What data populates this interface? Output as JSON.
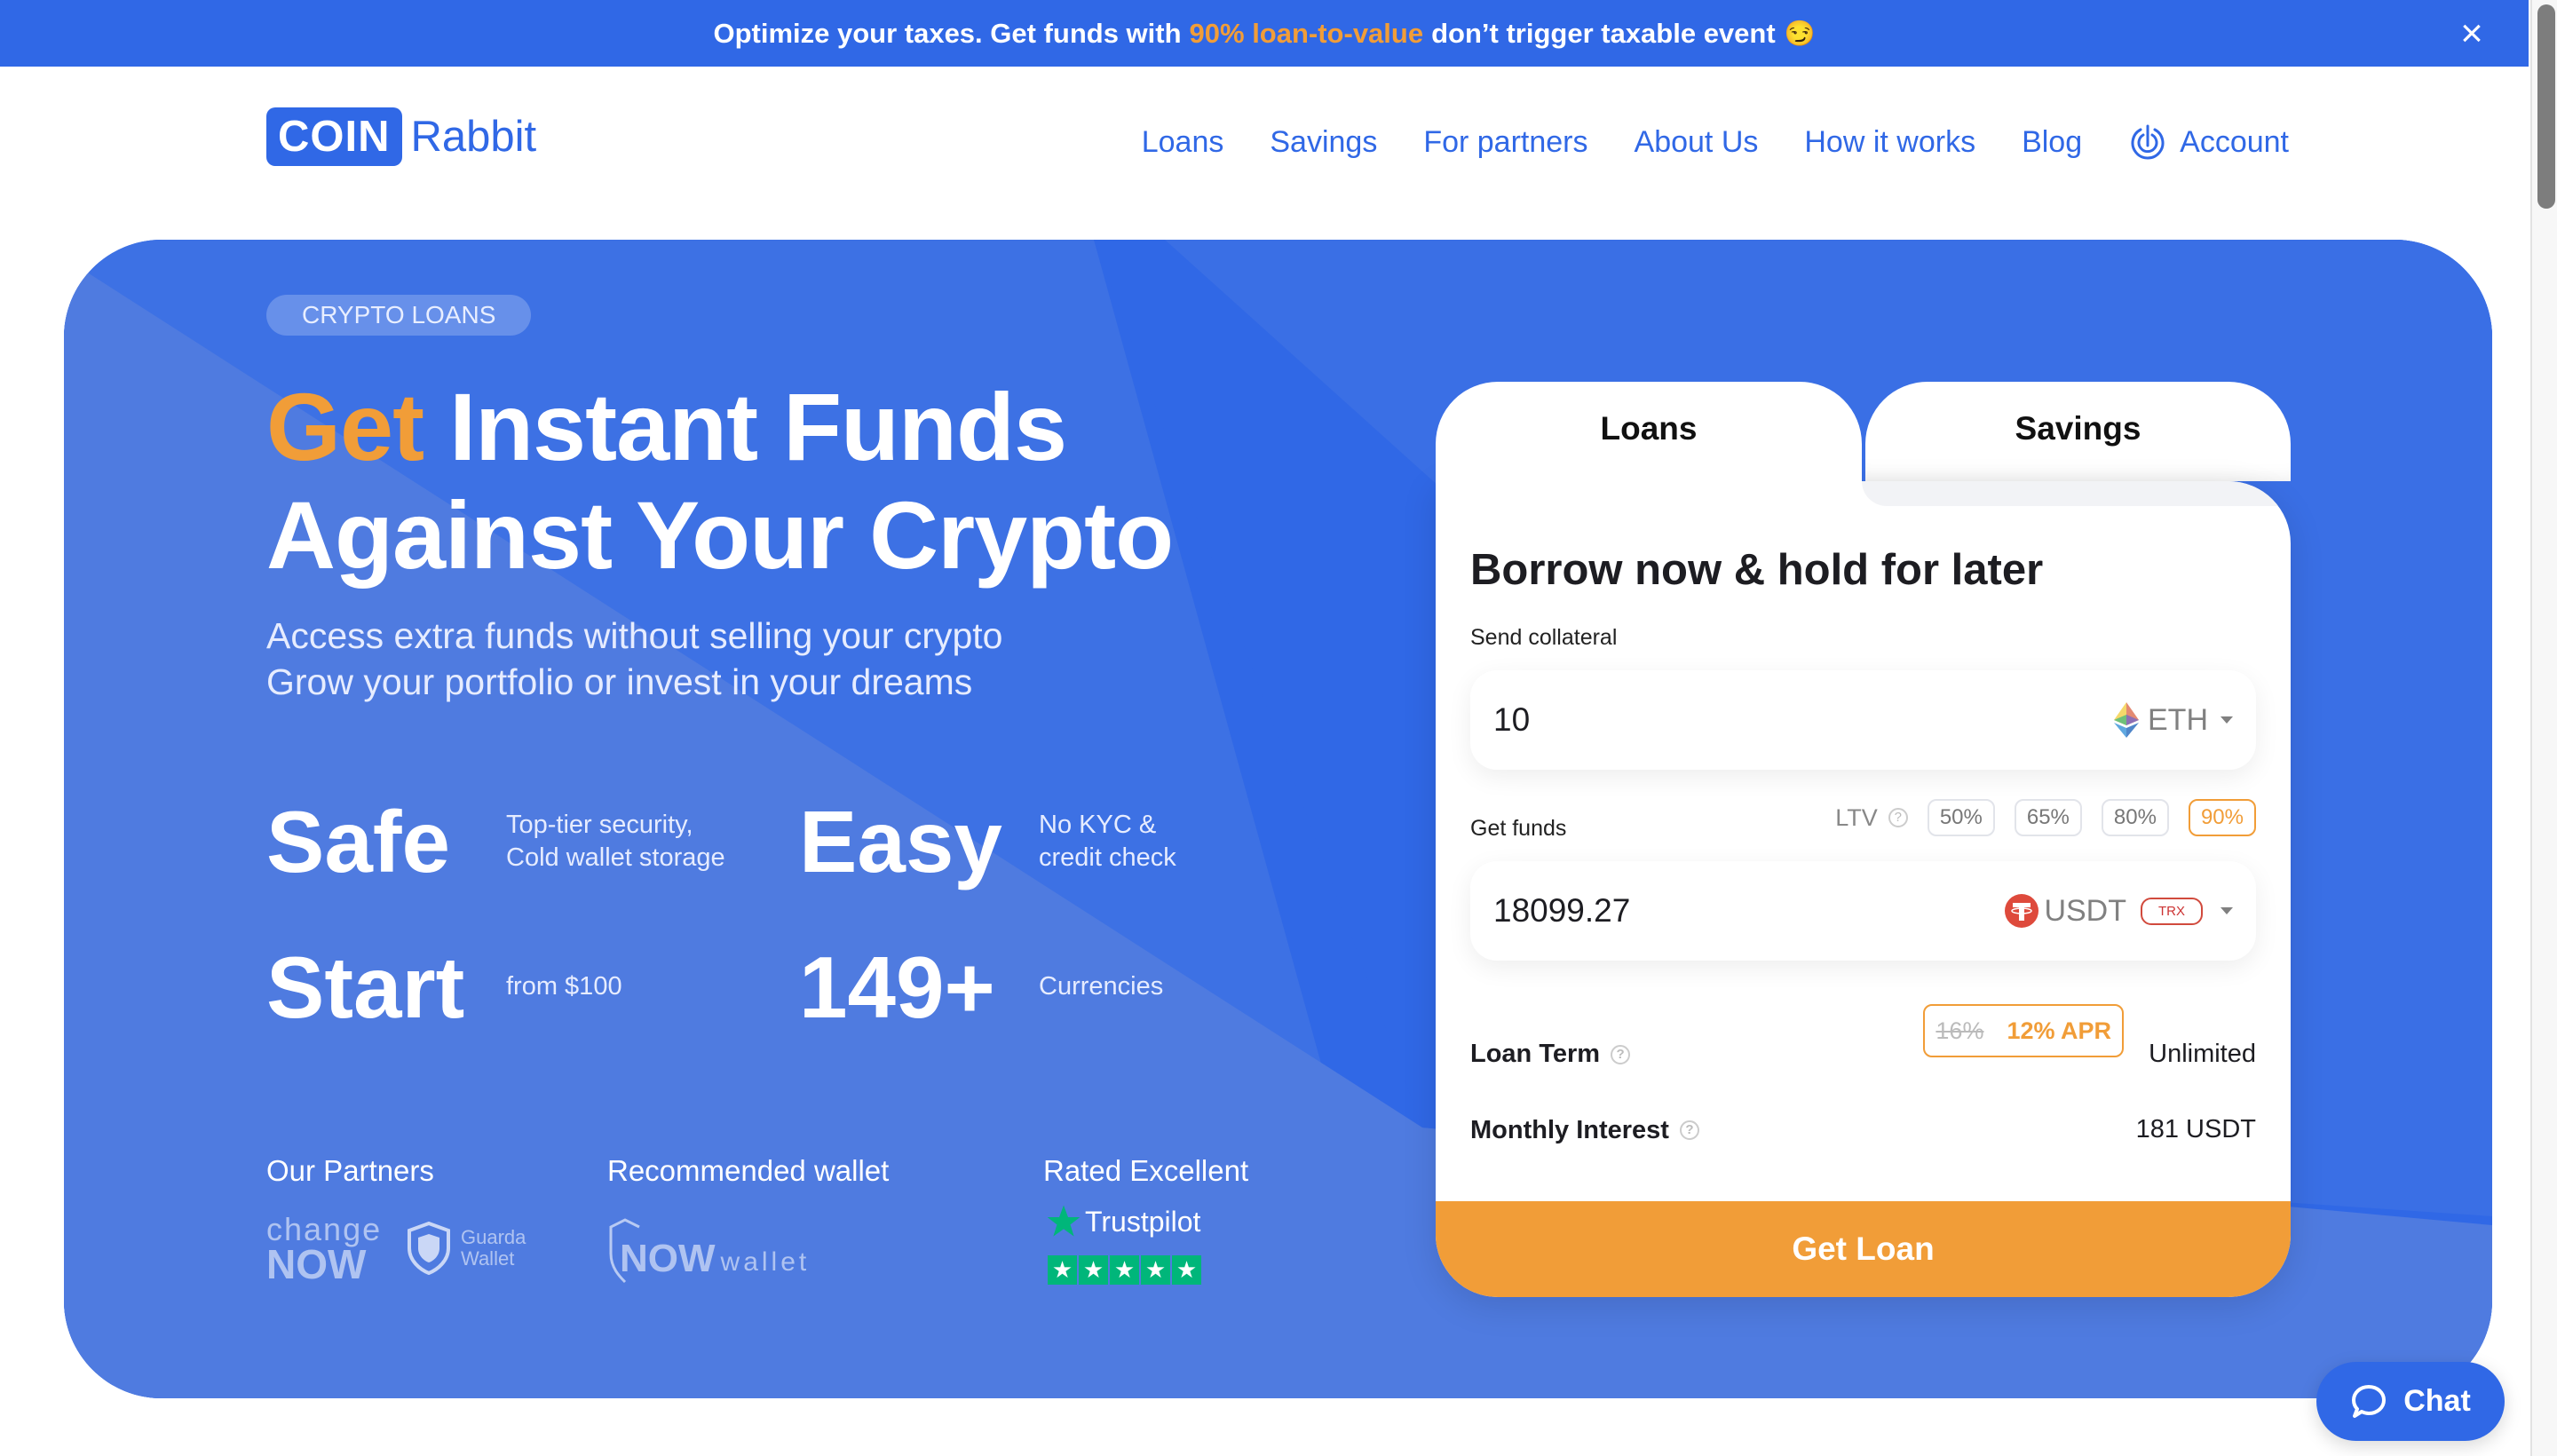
{
  "banner": {
    "text_before": "Optimize your taxes. Get funds with",
    "highlight": "90% loan-to-value",
    "text_after": "don’t trigger taxable event",
    "emoji": "😏",
    "close_icon": "close-icon"
  },
  "header": {
    "logo_coin": "COIN",
    "logo_rabbit": "Rabbit",
    "nav": [
      "Loans",
      "Savings",
      "For partners",
      "About Us",
      "How it works",
      "Blog"
    ],
    "account_label": "Account",
    "account_icon": "account-power-icon"
  },
  "hero": {
    "pill": "CRYPTO LOANS",
    "headline_accent": "Get",
    "headline_line1_rest": "Instant Funds",
    "headline_line2": "Against Your Crypto",
    "subtitle_line1": "Access extra funds without selling your crypto",
    "subtitle_line2": "Grow your portfolio or invest in your dreams",
    "stats": [
      {
        "big": "Safe",
        "line1": "Top-tier security,",
        "line2": "Cold wallet storage"
      },
      {
        "big": "Easy",
        "line1": "No KYC &",
        "line2": "credit check"
      },
      {
        "big": "Start",
        "line1": "from $100",
        "line2": ""
      },
      {
        "big": "149+",
        "line1": "Currencies",
        "line2": ""
      }
    ],
    "partners_title": "Our Partners",
    "partner_changenow_top": "change",
    "partner_changenow_bottom": "NOW",
    "partner_guarda_top": "Guarda",
    "partner_guarda_bottom": "Wallet",
    "wallet_title": "Recommended wallet",
    "wallet_now": "NOW",
    "wallet_word": "wallet",
    "rated_title": "Rated Excellent",
    "trustpilot": "Trustpilot",
    "trustpilot_stars": 5
  },
  "card": {
    "tabs": [
      "Loans",
      "Savings"
    ],
    "active_tab": "Loans",
    "title": "Borrow now & hold for later",
    "send_label": "Send collateral",
    "send_value": "10",
    "send_currency": "ETH",
    "get_label": "Get funds",
    "ltv_label": "LTV",
    "ltv_options": [
      "50%",
      "65%",
      "80%",
      "90%"
    ],
    "ltv_selected": "90%",
    "get_value": "18099.27",
    "get_currency": "USDT",
    "get_network": "TRX",
    "loan_term_label": "Loan Term",
    "loan_term_value": "Unlimited",
    "monthly_interest_label": "Monthly Interest",
    "apr_old": "16%",
    "apr_new": "12% APR",
    "monthly_interest_value": "181 USDT",
    "cta": "Get Loan"
  },
  "chat": {
    "label": "Chat"
  },
  "colors": {
    "brand_blue": "#3068e6",
    "accent_orange": "#f19d38",
    "trustpilot_green": "#00b67a",
    "tether_red": "#de4a3c"
  }
}
